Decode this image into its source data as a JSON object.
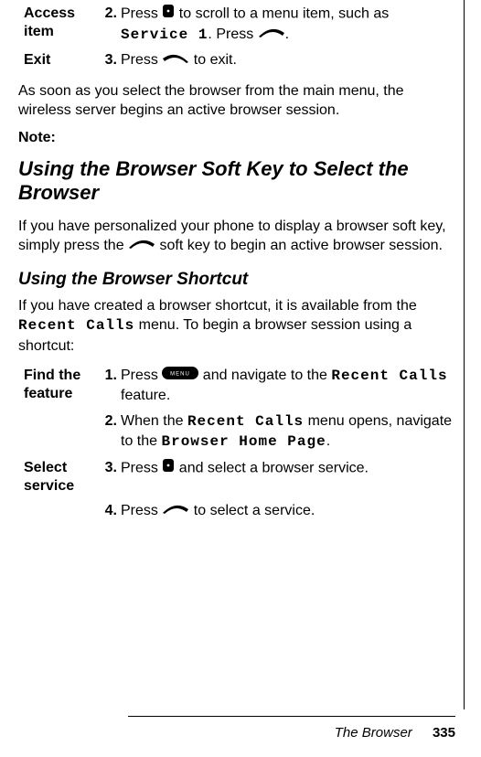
{
  "steps_top": {
    "access_item": {
      "label": "Access item",
      "num": "2.",
      "t1": "Press ",
      "t2": " to scroll to a menu item, such as ",
      "mono": "Service 1",
      "t3": ". Press ",
      "t4": "."
    },
    "exit": {
      "label": "Exit",
      "num": "3.",
      "t1": "Press ",
      "t2": " to exit."
    }
  },
  "para1": "As soon as you select the browser from the main menu, the wireless server begins an active browser session.",
  "note_label": "Note:",
  "heading1": "Using the Browser Soft Key to Select the Browser",
  "para2a": "If you have personalized your phone to display a browser soft key, simply press the ",
  "para2b": " soft key to begin an active browser session.",
  "heading2": "Using the Browser Shortcut",
  "para3a": "If you have created a browser shortcut, it is available from the ",
  "para3_mono1": "Recent Calls",
  "para3b": " menu. To begin a browser session using a shortcut:",
  "steps_bottom": {
    "find_feature": {
      "label": "Find the feature",
      "s1": {
        "num": "1.",
        "t1": "Press ",
        "t2": " and navigate to the ",
        "mono": "Recent Calls",
        "t3": " feature."
      },
      "s2": {
        "num": "2.",
        "t1": "When the ",
        "mono1": "Recent Calls",
        "t2": " menu opens, navigate to the ",
        "mono2": "Browser Home Page",
        "t3": "."
      }
    },
    "select_service": {
      "label": "Select service",
      "s3": {
        "num": "3.",
        "t1": "Press ",
        "t2": " and select a browser service."
      },
      "s4": {
        "num": "4.",
        "t1": "Press ",
        "t2": " to select a service."
      }
    }
  },
  "footer": {
    "title": "The Browser",
    "page": "335"
  }
}
